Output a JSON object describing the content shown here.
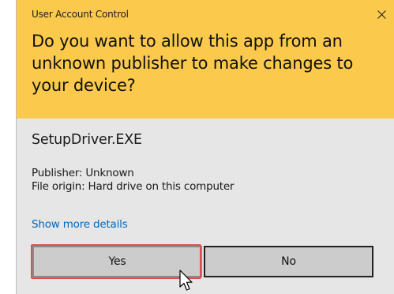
{
  "window": {
    "title": "User Account Control",
    "close_icon": "close-icon"
  },
  "prompt": {
    "question": "Do you want to allow this app from an unknown publisher to make changes to your device?"
  },
  "app": {
    "name": "SetupDriver.EXE",
    "publisher_line": "Publisher: Unknown",
    "origin_line": "File origin: Hard drive on this computer"
  },
  "links": {
    "show_more_details": "Show more details"
  },
  "buttons": {
    "yes": "Yes",
    "no": "No"
  },
  "colors": {
    "header_background": "#fbc94b",
    "body_background": "#e6e6e6",
    "link": "#0067c0",
    "highlight": "#e05050"
  }
}
